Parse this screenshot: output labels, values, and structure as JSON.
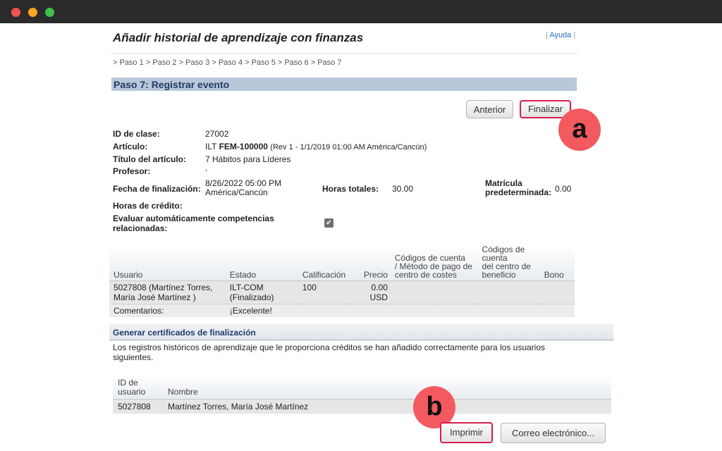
{
  "window": {
    "controls": [
      "close",
      "minimize",
      "maximize"
    ]
  },
  "page": {
    "title": "Añadir historial de aprendizaje con finanzas",
    "help": "Ayuda",
    "breadcrumb": "> Paso 1 > Paso 2 > Paso 3 > Paso 4 > Paso 5 > Paso 6 > Paso 7",
    "section_title": "Paso 7: Registrar evento"
  },
  "buttons": {
    "previous": "Anterior",
    "finish": "Finalizar",
    "print": "Imprimir",
    "email": "Correo electrónico..."
  },
  "annotations": {
    "a": "a",
    "b": "b"
  },
  "details": {
    "class_id_label": "ID de clase:",
    "class_id": "27002",
    "article_label": "Artículo:",
    "article_prefix": "ILT",
    "article_code": "FEM-100000",
    "article_rev": "(Rev 1 - 1/1/2019 01:00 AM América/Cancún)",
    "article_title_label": "Título del artículo:",
    "article_title": "7 Hábitos para Líderes",
    "instructor_label": "Profesor:",
    "instructor": ",",
    "end_date_label": "Fecha de finalización:",
    "end_date_line1": "8/26/2022 05:00 PM",
    "end_date_line2": "América/Cancún",
    "total_hours_label": "Horas totales:",
    "total_hours": "30.00",
    "default_tuition_label_1": "Matrícula",
    "default_tuition_label_2": "predeterminada:",
    "default_tuition": "0.00",
    "credit_hours_label": "Horas de crédito:",
    "credit_hours": "",
    "auto_eval_label_1": "Evaluar automáticamente competencias",
    "auto_eval_label_2": "relacionadas:",
    "auto_eval_checked": true
  },
  "users_table": {
    "headers": {
      "user": "Usuario",
      "status": "Estado",
      "grade": "Calificación",
      "price": "Precio",
      "cost_center_1": "Códigos de cuenta",
      "cost_center_2": "/ Método de pago de",
      "cost_center_3": "centro de costes",
      "profit_center_1": "Códigos de",
      "profit_center_2": "cuenta",
      "profit_center_3": "del centro de",
      "profit_center_4": "beneficio",
      "bonus": "Bono"
    },
    "row": {
      "user_1": "5027808 (Martínez Torres,",
      "user_2": "María José Martínez )",
      "status_1": "ILT-COM",
      "status_2": "(Finalizado)",
      "grade": "100",
      "price": "0.00 USD",
      "cost_center": "",
      "profit_center": "",
      "bonus": ""
    },
    "comments_label": "Comentarios:",
    "comments": "¡Excelente!"
  },
  "certificates": {
    "title": "Generar certificados de finalización",
    "message": "Los registros históricos de aprendizaje que le proporciona créditos se han añadido correctamente para los usuarios siguientes.",
    "headers": {
      "user_id_1": "ID de",
      "user_id_2": "usuario",
      "name": "Nombre"
    },
    "rows": [
      {
        "user_id": "5027808",
        "name": "Martínez Torres, María José Martínez"
      }
    ]
  },
  "colors": {
    "section_header_bg": "#b8c7d9",
    "section_header_text": "#1f3c68",
    "highlight_border": "#d61f4d",
    "annotation_badge": "#f25a60",
    "link": "#2a6ebb"
  }
}
